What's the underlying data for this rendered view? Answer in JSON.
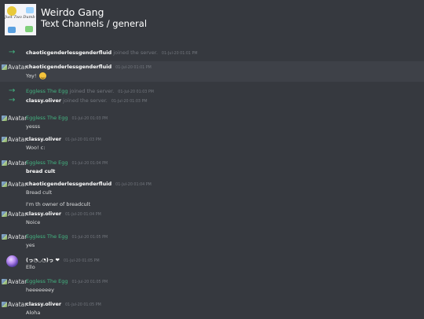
{
  "header": {
    "server_name": "Weirdo Gang",
    "channel_path": "Text Channels / general",
    "icon_text": "Just Two Dumb Ones"
  },
  "avatar_alt": "Avatar",
  "messages": [
    {
      "kind": "system",
      "name": "chaoticgenderlessgenderfluid",
      "name_color": "white",
      "text": "joined the server.",
      "ts": "01-Jul-20 01:01 PM"
    },
    {
      "kind": "message",
      "author": "chaoticgenderlessgenderfluid",
      "author_color": "white",
      "ts": "01-Jul-20 01:01 PM",
      "lines": [
        "Yay!"
      ],
      "emoji": "smile-emoji",
      "highlight": true
    },
    {
      "kind": "system",
      "name": "Eggless The Egg",
      "name_color": "green",
      "text": "joined the server.",
      "ts": "01-Jul-20 01:03 PM"
    },
    {
      "kind": "system",
      "name": "classy.oliver",
      "name_color": "white",
      "text": "joined the server.",
      "ts": "01-Jul-20 01:03 PM"
    },
    {
      "kind": "message",
      "author": "Eggless The Egg",
      "author_color": "green",
      "ts": "01-Jul-20 01:03 PM",
      "lines": [
        "yesss"
      ]
    },
    {
      "kind": "message",
      "author": "classy.oliver",
      "author_color": "white",
      "ts": "01-Jul-20 01:03 PM",
      "lines": [
        "Woo! c:"
      ]
    },
    {
      "kind": "message",
      "author": "Eggless The Egg",
      "author_color": "green",
      "ts": "01-Jul-20 01:04 PM",
      "lines": [
        "bread cult"
      ],
      "bold": true
    },
    {
      "kind": "message",
      "author": "chaoticgenderlessgenderfluid",
      "author_color": "white",
      "ts": "01-Jul-20 01:04 PM",
      "lines": [
        "Bread cult",
        "I'm th owner of breadcult"
      ]
    },
    {
      "kind": "message",
      "author": "classy.oliver",
      "author_color": "white",
      "ts": "01-Jul-20 01:04 PM",
      "lines": [
        "Noice"
      ]
    },
    {
      "kind": "message",
      "author": "Eggless The Egg",
      "author_color": "green",
      "ts": "01-Jul-20 01:05 PM",
      "lines": [
        "yes"
      ]
    },
    {
      "kind": "message",
      "author": "(っ◔◡◔)っ ❤",
      "author_color": "white",
      "ts": "01-Jul-20 01:05 PM",
      "lines": [
        "Ello"
      ],
      "real_avatar": true
    },
    {
      "kind": "message",
      "author": "Eggless The Egg",
      "author_color": "green",
      "ts": "01-Jul-20 01:05 PM",
      "lines": [
        "heeeeeeey"
      ]
    },
    {
      "kind": "message",
      "author": "classy.oliver",
      "author_color": "white",
      "ts": "01-Jul-20 01:05 PM",
      "lines": [
        "Aloha"
      ]
    }
  ]
}
